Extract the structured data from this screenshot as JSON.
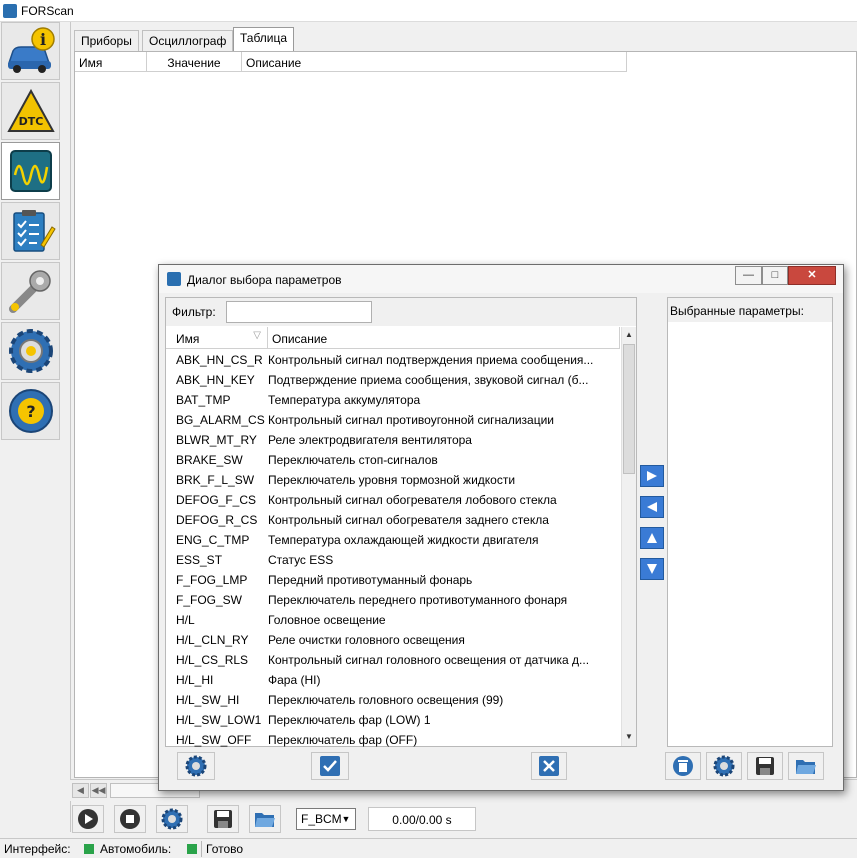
{
  "window": {
    "title": "FORScan"
  },
  "sidebar": {
    "items": [
      {
        "name": "vehicle-info",
        "icon": "car-info-icon"
      },
      {
        "name": "dtc",
        "icon": "dtc-warning-icon",
        "label": "DTC"
      },
      {
        "name": "oscilloscope",
        "icon": "oscilloscope-icon"
      },
      {
        "name": "tests",
        "icon": "checklist-icon"
      },
      {
        "name": "service",
        "icon": "wrench-icon"
      },
      {
        "name": "configuration",
        "icon": "gear-icon"
      },
      {
        "name": "help",
        "icon": "help-icon"
      }
    ]
  },
  "tabs": [
    {
      "label": "Приборы",
      "active": false
    },
    {
      "label": "Осциллограф",
      "active": false
    },
    {
      "label": "Таблица",
      "active": true
    }
  ],
  "main_table": {
    "columns": [
      "Имя",
      "Значение",
      "Описание"
    ]
  },
  "dialog": {
    "title": "Диалог выбора параметров",
    "filter_label": "Фильтр:",
    "filter_value": "",
    "columns": {
      "name": "Имя",
      "description": "Описание"
    },
    "rows": [
      {
        "name": "ABK_HN_CS_R",
        "desc": "Контрольный сигнал подтверждения приема сообщения..."
      },
      {
        "name": "ABK_HN_KEY",
        "desc": "Подтверждение приема сообщения, звуковой сигнал (б..."
      },
      {
        "name": "BAT_TMP",
        "desc": "Температура аккумулятора"
      },
      {
        "name": "BG_ALARM_CS",
        "desc": "Контрольный сигнал противоугонной сигнализации"
      },
      {
        "name": "BLWR_MT_RY",
        "desc": "Реле электродвигателя вентилятора"
      },
      {
        "name": "BRAKE_SW",
        "desc": "Переключатель стоп-сигналов"
      },
      {
        "name": "BRK_F_L_SW",
        "desc": "Переключатель уровня тормозной жидкости"
      },
      {
        "name": "DEFOG_F_CS",
        "desc": "Контрольный сигнал обогревателя лобового стекла"
      },
      {
        "name": "DEFOG_R_CS",
        "desc": "Контрольный сигнал обогревателя заднего стекла"
      },
      {
        "name": "ENG_C_TMP",
        "desc": "Температура охлаждающей жидкости двигателя"
      },
      {
        "name": "ESS_ST",
        "desc": "Статус ESS"
      },
      {
        "name": "F_FOG_LMP",
        "desc": "Передний противотуманный фонарь"
      },
      {
        "name": "F_FOG_SW",
        "desc": "Переключатель переднего противотуманного фонаря"
      },
      {
        "name": "H/L",
        "desc": "Головное освещение"
      },
      {
        "name": "H/L_CLN_RY",
        "desc": "Реле очистки головного освещения"
      },
      {
        "name": "H/L_CS_RLS",
        "desc": "Контрольный сигнал головного освещения от датчика д..."
      },
      {
        "name": "H/L_HI",
        "desc": "Фара (HI)"
      },
      {
        "name": "H/L_SW_HI",
        "desc": "Переключатель головного освещения (99)"
      },
      {
        "name": "H/L_SW_LOW1",
        "desc": "Переключатель фар (LOW) 1"
      },
      {
        "name": "H/L_SW_OFF",
        "desc": "Переключатель фар (OFF)"
      }
    ],
    "selected_title": "Выбранные параметры:",
    "colors": {
      "accent": "#3a7bd5",
      "close": "#c9483e"
    }
  },
  "toolbar": {
    "module": "F_BCM",
    "time": "0.00/0.00 s"
  },
  "status": {
    "interface_label": "Интерфейс:",
    "vehicle_label": "Автомобиль:",
    "state": "Готово",
    "led_color": "#2aa34a"
  }
}
